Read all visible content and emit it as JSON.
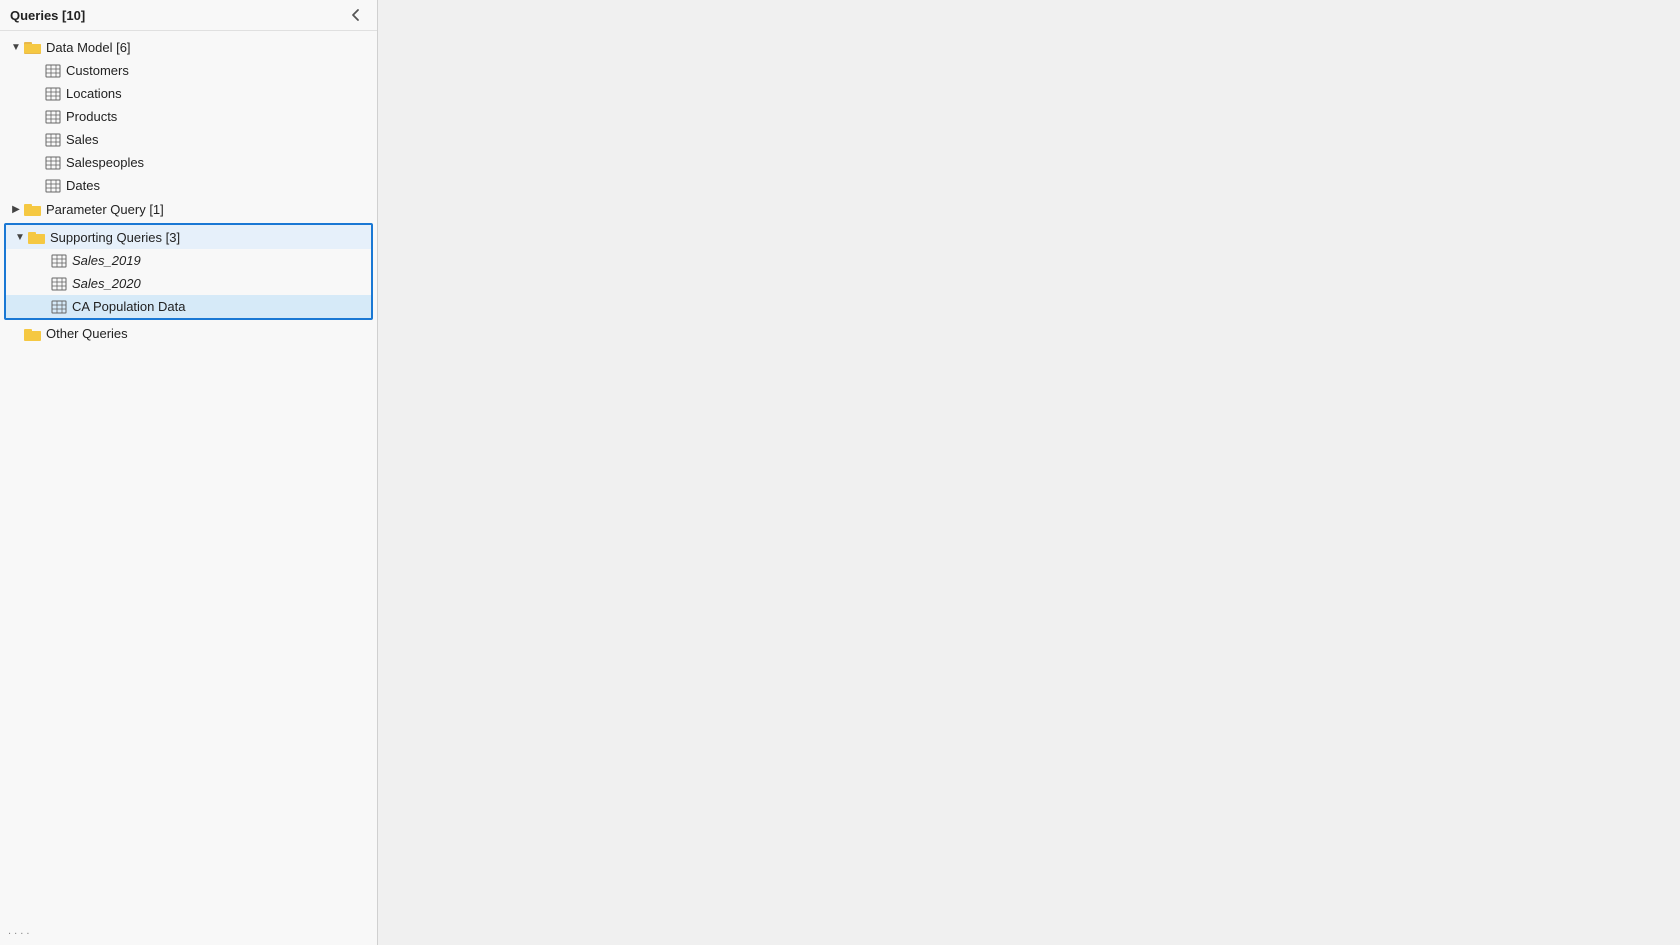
{
  "sidebar": {
    "title": "Queries [10]",
    "collapse_icon": "◀",
    "tree": {
      "groups": [
        {
          "id": "data-model",
          "label": "Data Model [6]",
          "expanded": true,
          "indent": 0,
          "children": [
            {
              "id": "customers",
              "label": "Customers",
              "indent": 1
            },
            {
              "id": "locations",
              "label": "Locations",
              "indent": 1
            },
            {
              "id": "products",
              "label": "Products",
              "indent": 1
            },
            {
              "id": "sales",
              "label": "Sales",
              "indent": 1
            },
            {
              "id": "salespeople",
              "label": "Salespeoples",
              "indent": 1
            },
            {
              "id": "dates",
              "label": "Dates",
              "indent": 1
            }
          ]
        },
        {
          "id": "parameter-query",
          "label": "Parameter Query [1]",
          "expanded": false,
          "indent": 0,
          "children": []
        },
        {
          "id": "supporting-queries",
          "label": "Supporting Queries [3]",
          "expanded": true,
          "indent": 0,
          "selected_group": true,
          "children": [
            {
              "id": "sales-2019",
              "label": "Sales_2019",
              "indent": 1,
              "italic": true
            },
            {
              "id": "sales-2020",
              "label": "Sales_2020",
              "indent": 1,
              "italic": true
            },
            {
              "id": "ca-population",
              "label": "CA Population Data",
              "indent": 1,
              "italic": false,
              "selected": true
            }
          ]
        },
        {
          "id": "other-queries",
          "label": "Other Queries",
          "expanded": false,
          "indent": 0,
          "children": []
        }
      ]
    }
  },
  "icons": {
    "collapse": "❮",
    "expand_arrow": "▶",
    "collapse_arrow": "▼",
    "folder": "folder",
    "table": "table"
  }
}
